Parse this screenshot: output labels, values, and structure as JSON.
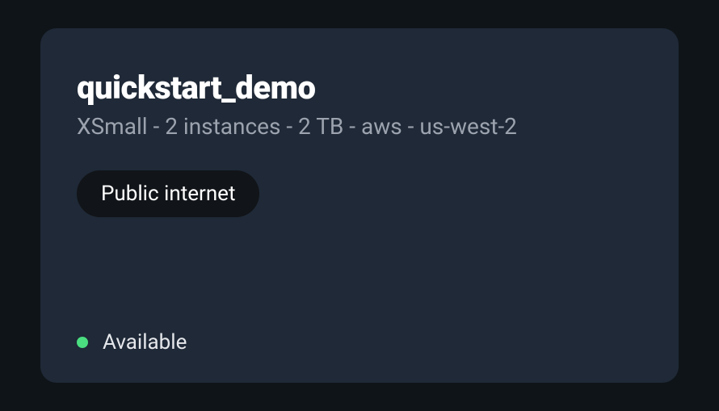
{
  "card": {
    "title": "quickstart_demo",
    "subtitle": "XSmall - 2 instances - 2 TB - aws - us-west-2",
    "network_badge": "Public internet",
    "status": {
      "label": "Available",
      "color": "#4ade80"
    }
  }
}
